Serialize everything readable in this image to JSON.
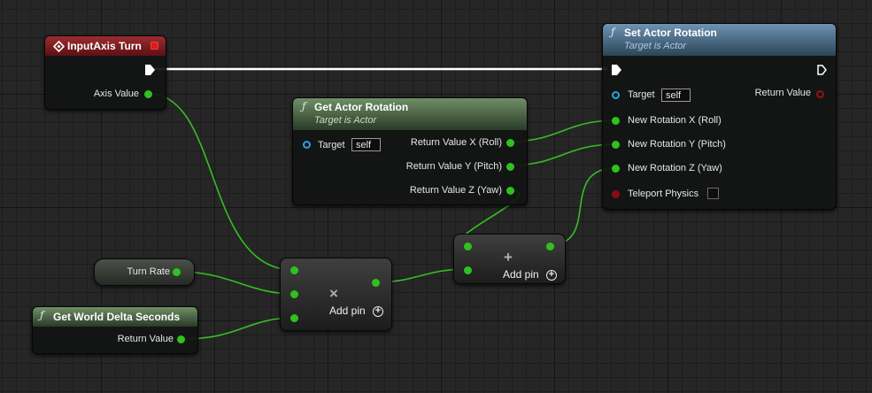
{
  "colors": {
    "float_pin": "#2fc11f",
    "object_pin": "#29a3e2",
    "bool_pin": "#9a1010",
    "exec_pin": "#ffffff",
    "event_header": "#8f2226",
    "pure_function_header": "#5e7c57",
    "function_header": "#557a99"
  },
  "input_axis_node": {
    "title": "InputAxis Turn",
    "axis_value_label": "Axis Value",
    "icon": "event-diamond-icon"
  },
  "set_actor_rotation_node": {
    "title": "Set Actor Rotation",
    "subtitle": "Target is Actor",
    "icon": "function-icon",
    "target_label": "Target",
    "target_value": "self",
    "return_label": "Return Value",
    "roll_label": "New Rotation X (Roll)",
    "pitch_label": "New Rotation Y (Pitch)",
    "yaw_label": "New Rotation Z (Yaw)",
    "teleport_label": "Teleport Physics"
  },
  "get_actor_rotation_node": {
    "title": "Get Actor Rotation",
    "subtitle": "Target is Actor",
    "icon": "function-icon",
    "target_label": "Target",
    "target_value": "self",
    "return_x_label": "Return Value X (Roll)",
    "return_y_label": "Return Value Y (Pitch)",
    "return_z_label": "Return Value Z (Yaw)"
  },
  "turn_rate_node": {
    "label": "Turn Rate"
  },
  "delta_seconds_node": {
    "title": "Get World Delta Seconds",
    "return_label": "Return Value",
    "icon": "function-icon"
  },
  "multiply_node": {
    "symbol": "×",
    "add_pin_label": "Add pin",
    "add_icon": "plus-circle-icon"
  },
  "add_node": {
    "symbol": "+",
    "add_pin_label": "Add pin",
    "add_icon": "plus-circle-icon"
  }
}
